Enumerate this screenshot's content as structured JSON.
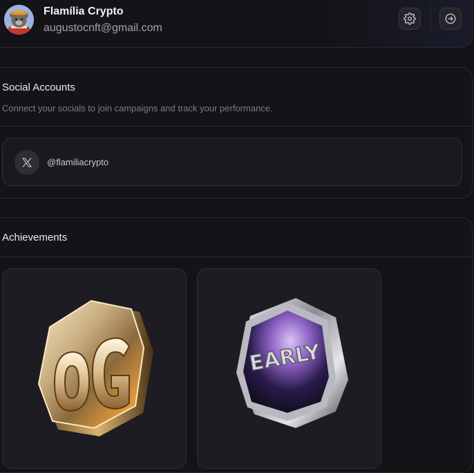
{
  "profile": {
    "name": "Flamília Crypto",
    "email": "augustocnft@gmail.com",
    "avatar_icon": "bear-avatar-icon",
    "settings_icon": "gear-icon",
    "logout_icon": "logout-icon"
  },
  "social": {
    "title": "Social Accounts",
    "subtitle": "Connect your socials to join campaigns and track your performance.",
    "accounts": [
      {
        "platform_icon": "x-icon",
        "handle": "@flamiliacrypto"
      }
    ]
  },
  "achievements": {
    "title": "Achievements",
    "badges": [
      {
        "label": "OG",
        "icon": "og-badge-icon"
      },
      {
        "label": "EARLY",
        "icon": "early-badge-icon"
      }
    ]
  },
  "colors": {
    "background": "#121116",
    "card": "#141318",
    "border": "#2b2a31",
    "muted_text": "#7c7a86"
  }
}
